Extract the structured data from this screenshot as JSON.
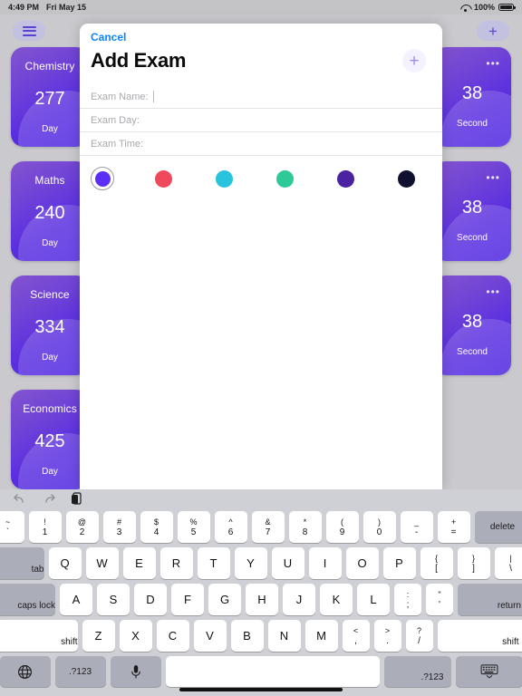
{
  "statusbar": {
    "time": "4:49 PM",
    "date": "Fri May 15",
    "battery": "100%",
    "wifi_icon": "wifi-icon",
    "battery_icon": "battery-icon"
  },
  "app": {
    "menu_icon": "hamburger-menu-icon",
    "add_icon": "plus-icon",
    "left_cards": [
      {
        "title": "Chemistry",
        "value": "277",
        "unit": "Day"
      },
      {
        "title": "Maths",
        "value": "240",
        "unit": "Day"
      },
      {
        "title": "Science",
        "value": "334",
        "unit": "Day"
      },
      {
        "title": "Economics",
        "value": "425",
        "unit": "Day"
      }
    ],
    "right_cards": [
      {
        "dots": "•••",
        "value": "38",
        "unit": "Second"
      },
      {
        "dots": "•••",
        "value": "38",
        "unit": "Second"
      },
      {
        "dots": "•••",
        "value": "38",
        "unit": "Second"
      }
    ]
  },
  "sheet": {
    "cancel": "Cancel",
    "title": "Add Exam",
    "add_icon": "plus-icon",
    "fields": [
      {
        "label": "Exam Name:",
        "value": "",
        "focused": true
      },
      {
        "label": "Exam Day:",
        "value": "",
        "focused": false
      },
      {
        "label": "Exam Time:",
        "value": "",
        "focused": false
      }
    ],
    "colors": [
      {
        "hex": "#5b2ff5",
        "selected": true
      },
      {
        "hex": "#f1495c",
        "selected": false
      },
      {
        "hex": "#28c3dd",
        "selected": false
      },
      {
        "hex": "#2dc997",
        "selected": false
      },
      {
        "hex": "#4b22a0",
        "selected": false
      },
      {
        "hex": "#0f1030",
        "selected": false
      }
    ]
  },
  "keyboard": {
    "tools": [
      "undo-icon",
      "redo-icon",
      "paste-icon"
    ],
    "row1": [
      {
        "up": "~",
        "lo": "`"
      },
      {
        "up": "!",
        "lo": "1"
      },
      {
        "up": "@",
        "lo": "2"
      },
      {
        "up": "#",
        "lo": "3"
      },
      {
        "up": "$",
        "lo": "4"
      },
      {
        "up": "%",
        "lo": "5"
      },
      {
        "up": "^",
        "lo": "6"
      },
      {
        "up": "&",
        "lo": "7"
      },
      {
        "up": "*",
        "lo": "8"
      },
      {
        "up": "(",
        "lo": "9"
      },
      {
        "up": ")",
        "lo": "0"
      },
      {
        "up": "_",
        "lo": "-"
      },
      {
        "up": "+",
        "lo": "="
      }
    ],
    "delete": "delete",
    "tab": "tab",
    "row2": [
      "Q",
      "W",
      "E",
      "R",
      "T",
      "Y",
      "U",
      "I",
      "O",
      "P"
    ],
    "row2_dual": [
      {
        "up": "{",
        "lo": "["
      },
      {
        "up": "}",
        "lo": "]"
      },
      {
        "up": "|",
        "lo": "\\"
      }
    ],
    "caps": "caps lock",
    "row3": [
      "A",
      "S",
      "D",
      "F",
      "G",
      "H",
      "J",
      "K",
      "L"
    ],
    "row3_dual": [
      {
        "up": ":",
        "lo": ";"
      },
      {
        "up": "\"",
        "lo": "'"
      }
    ],
    "return": "return",
    "shift_left": "shift",
    "row4": [
      "Z",
      "X",
      "C",
      "V",
      "B",
      "N",
      "M"
    ],
    "row4_dual": [
      {
        "up": "<",
        "lo": ","
      },
      {
        "up": ">",
        "lo": "."
      },
      {
        "up": "?",
        "lo": "/"
      }
    ],
    "shift_right": "shift",
    "globe_icon": "globe-icon",
    "numeric_left": ".?123",
    "mic_icon": "microphone-icon",
    "space": "",
    "numeric_right": ".?123",
    "dismiss_icon": "keyboard-dismiss-icon"
  }
}
